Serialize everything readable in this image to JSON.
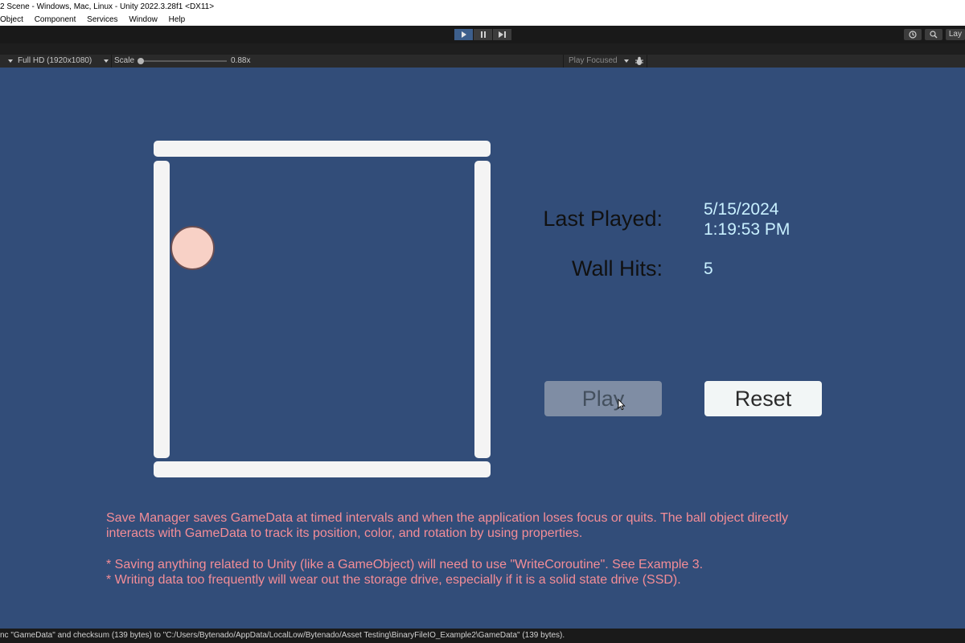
{
  "window": {
    "title": "2 Scene - Windows, Mac, Linux - Unity 2022.3.28f1 <DX11>"
  },
  "menu": {
    "items": [
      "Object",
      "Component",
      "Services",
      "Window",
      "Help"
    ]
  },
  "toolbar": {
    "layout_label": "Lay"
  },
  "game_view_bar": {
    "resolution": "Full HD (1920x1080)",
    "scale_label": "Scale",
    "scale_value": "0.88x",
    "play_focused": "Play Focused"
  },
  "game": {
    "last_played_label": "Last Played:",
    "last_played_date": "5/15/2024",
    "last_played_time": "1:19:53 PM",
    "wall_hits_label": "Wall Hits:",
    "wall_hits_value": "5",
    "play_button": "Play",
    "reset_button": "Reset",
    "info_line1": "Save Manager saves GameData at timed intervals and when the application loses focus or quits. The ball object directly",
    "info_line2": "interacts with GameData to track its position, color, and rotation by using properties.",
    "info_line3": "* Saving anything related to Unity (like a GameObject) will need to use \"WriteCoroutine\". See Example 3.",
    "info_line4": "* Writing data too frequently will wear out the storage drive, especially if it is a solid state drive (SSD)."
  },
  "status": {
    "message": "nc \"GameData\" and checksum (139 bytes) to \"C:/Users/Bytenado/AppData/LocalLow/Bytenado/Asset Testing\\BinaryFileIO_Example2\\GameData\" (139 bytes)."
  },
  "colors": {
    "viewport_bg": "#324d79",
    "wall": "#f4f4f4",
    "ball_fill": "#f8d1c6",
    "info_text": "#f48d97",
    "value_text": "#c8f0ff",
    "play_active": "#3d5f8c"
  }
}
